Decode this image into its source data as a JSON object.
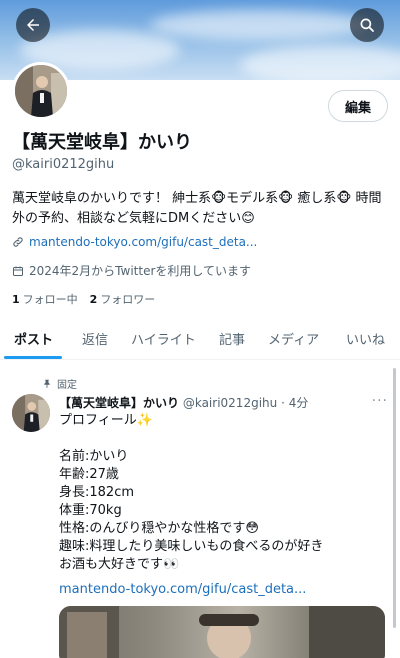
{
  "header": {
    "back_icon": "arrow-left-icon",
    "search_icon": "search-icon"
  },
  "profile": {
    "edit_label": "編集",
    "name": "【萬天堂岐阜】かいり",
    "handle": "@kairi0212gihu",
    "bio_line1": "萬天堂岐阜のかいりです！ 紳士系🐵モデル系🐵 癒し系🐵 時間",
    "bio_line2": "外の予約、相談など気軽にDMください😊",
    "link": "mantendo-tokyo.com/gifu/cast_deta...",
    "joined": "2024年2月からTwitterを利用しています",
    "following_count": "1",
    "following_label": "フォロー中",
    "followers_count": "2",
    "followers_label": "フォロワー"
  },
  "tabs": [
    "ポスト",
    "返信",
    "ハイライト",
    "記事",
    "メディア",
    "いいね"
  ],
  "active_tab": "ポスト",
  "post": {
    "pinned_label": "固定",
    "author_name": "【萬天堂岐阜】かいり",
    "author_handle": "@kairi0212gihu",
    "time": "· 4分",
    "more_label": "···",
    "lines": [
      "プロフィール✨",
      "",
      "名前:かいり",
      "年齢:27歳",
      "身長:182cm",
      "体重:70kg",
      "性格:のんびり穏やかな性格です😳",
      "趣味:料理したり美味しいもの食べるのが好き",
      "お酒も大好きです👀"
    ],
    "link": "mantendo-tokyo.com/gifu/cast_deta..."
  },
  "colors": {
    "accent": "#1d9bf0",
    "link": "#1d6fba",
    "muted": "#536471"
  }
}
